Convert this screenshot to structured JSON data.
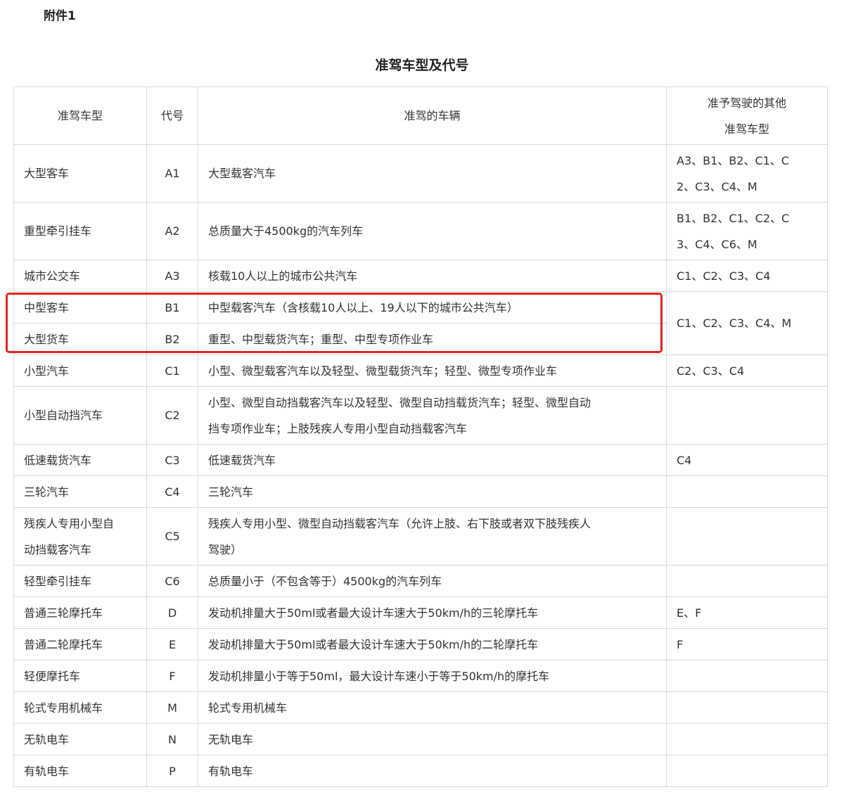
{
  "attachment_label": "附件1",
  "title": "准驾车型及代号",
  "headers": {
    "type": "准驾车型",
    "code": "代号",
    "vehicles": "准驾的车辆",
    "other": [
      "准予驾驶的其他",
      "准驾车型"
    ]
  },
  "rows": [
    {
      "type": [
        "大型客车"
      ],
      "code": "A1",
      "vehicles": [
        "大型载客汽车"
      ],
      "other": [
        "A3、B1、B2、C1、C",
        "2、C3、C4、M"
      ]
    },
    {
      "type": [
        "重型牵引挂车"
      ],
      "code": "A2",
      "vehicles": [
        "总质量大于4500kg的汽车列车"
      ],
      "other": [
        "B1、B2、C1、C2、C",
        "3、C4、C6、M"
      ]
    },
    {
      "type": [
        "城市公交车"
      ],
      "code": "A3",
      "vehicles": [
        "核载10人以上的城市公共汽车"
      ],
      "other": [
        "C1、C2、C3、C4"
      ]
    },
    {
      "type": [
        "中型客车"
      ],
      "code": "B1",
      "vehicles": [
        "中型载客汽车（含核载10人以上、19人以下的城市公共汽车）"
      ],
      "other": [
        "C1、C2、C3、C4、M"
      ]
    },
    {
      "type": [
        "大型货车"
      ],
      "code": "B2",
      "vehicles": [
        "重型、中型载货汽车；重型、中型专项作业车"
      ],
      "other": []
    },
    {
      "type": [
        "小型汽车"
      ],
      "code": "C1",
      "vehicles": [
        "小型、微型载客汽车以及轻型、微型载货汽车；轻型、微型专项作业车"
      ],
      "other": [
        "C2、C3、C4"
      ]
    },
    {
      "type": [
        "小型自动挡汽车"
      ],
      "code": "C2",
      "vehicles": [
        "小型、微型自动挡载客汽车以及轻型、微型自动挡载货汽车；轻型、微型自动",
        "挡专项作业车；上肢残疾人专用小型自动挡载客汽车"
      ],
      "other": []
    },
    {
      "type": [
        "低速载货汽车"
      ],
      "code": "C3",
      "vehicles": [
        "低速载货汽车"
      ],
      "other": [
        "C4"
      ]
    },
    {
      "type": [
        "三轮汽车"
      ],
      "code": "C4",
      "vehicles": [
        "三轮汽车"
      ],
      "other": []
    },
    {
      "type": [
        "残疾人专用小型自",
        "动挡载客汽车"
      ],
      "code": "C5",
      "vehicles": [
        "残疾人专用小型、微型自动挡载客汽车（允许上肢、右下肢或者双下肢残疾人",
        "驾驶）"
      ],
      "other": []
    },
    {
      "type": [
        "轻型牵引挂车"
      ],
      "code": "C6",
      "vehicles": [
        "总质量小于（不包含等于）4500kg的汽车列车"
      ],
      "other": []
    },
    {
      "type": [
        "普通三轮摩托车"
      ],
      "code": "D",
      "vehicles": [
        "发动机排量大于50ml或者最大设计车速大于50km/h的三轮摩托车"
      ],
      "other": [
        "E、F"
      ]
    },
    {
      "type": [
        "普通二轮摩托车"
      ],
      "code": "E",
      "vehicles": [
        "发动机排量大于50ml或者最大设计车速大于50km/h的二轮摩托车"
      ],
      "other": [
        "F"
      ]
    },
    {
      "type": [
        "轻便摩托车"
      ],
      "code": "F",
      "vehicles": [
        "发动机排量小于等于50ml，最大设计车速小于等于50km/h的摩托车"
      ],
      "other": []
    },
    {
      "type": [
        "轮式专用机械车"
      ],
      "code": "M",
      "vehicles": [
        "轮式专用机械车"
      ],
      "other": []
    },
    {
      "type": [
        "无轨电车"
      ],
      "code": "N",
      "vehicles": [
        "无轨电车"
      ],
      "other": []
    },
    {
      "type": [
        "有轨电车"
      ],
      "code": "P",
      "vehicles": [
        "有轨电车"
      ],
      "other": []
    }
  ],
  "highlight_color": "#e8211b"
}
